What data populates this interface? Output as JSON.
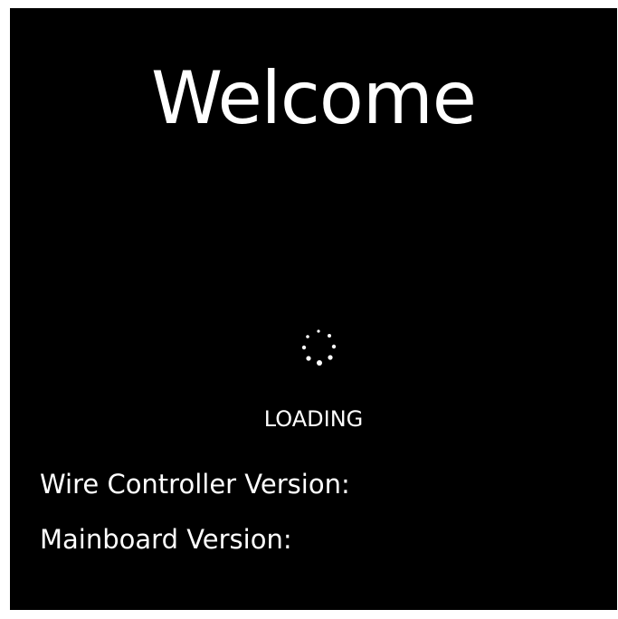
{
  "welcome": {
    "title": "Welcome",
    "loading_label": "LOADING"
  },
  "versions": {
    "wire_controller_label": "Wire Controller Version:",
    "mainboard_label": "Mainboard Version:"
  },
  "icons": {
    "spinner": "loading-spinner-icon"
  },
  "colors": {
    "background": "#000000",
    "text": "#ffffff"
  }
}
